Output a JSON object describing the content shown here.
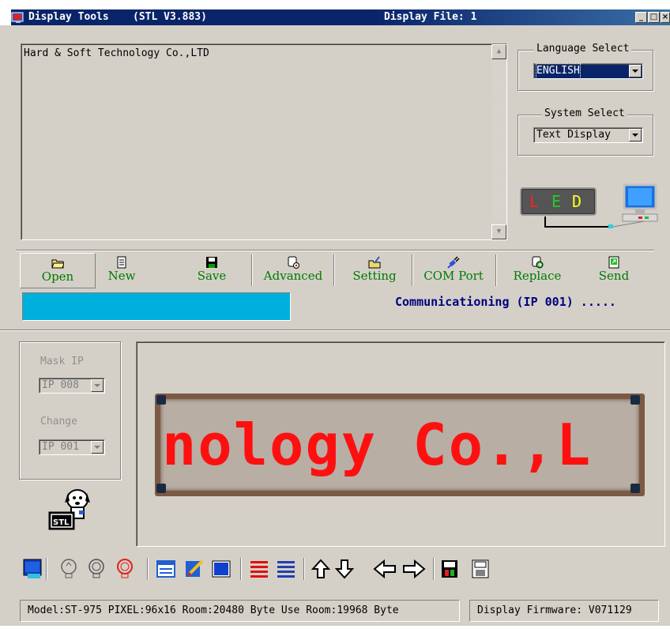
{
  "window": {
    "app_title": "Display Tools",
    "version": "(STL V3.883)",
    "file_label": "Display File: 1"
  },
  "editor": {
    "text": "Hard & Soft Technology Co.,LTD"
  },
  "language_select": {
    "legend": "Language Select",
    "value": "ENGLISH"
  },
  "system_select": {
    "legend": "System Select",
    "value": "Text Display"
  },
  "led_logo": {
    "letters": [
      "L",
      "E",
      "D"
    ],
    "colors": [
      "#ff2020",
      "#20d020",
      "#ffff20"
    ]
  },
  "toolbar": {
    "buttons": [
      {
        "label": "Open",
        "icon": "folder-open-icon"
      },
      {
        "label": "New",
        "icon": "new-document-icon"
      },
      {
        "label": "Save",
        "icon": "floppy-disk-icon"
      },
      {
        "label": "Advanced",
        "icon": "advanced-gear-icon"
      },
      {
        "label": "Setting",
        "icon": "setting-icon"
      },
      {
        "label": "COM Port",
        "icon": "com-port-plug-icon"
      },
      {
        "label": "Replace",
        "icon": "replace-icon"
      },
      {
        "label": "Send",
        "icon": "send-icon"
      }
    ]
  },
  "status": {
    "progress_fraction": 1.0,
    "text": "Communicationing (IP 001) ....."
  },
  "mask": {
    "mask_label": "Mask IP",
    "mask_value": "IP 008",
    "change_label": "Change",
    "change_value": "IP 001"
  },
  "mascot": {
    "badge_text": "STL"
  },
  "preview": {
    "text": "nology Co.,L",
    "text_color": "#ff1010"
  },
  "bottom_icons": [
    "screen-effect-icon",
    "bulb-outline-icon",
    "bulb-dim-icon",
    "bulb-red-icon",
    "window-frame-icon",
    "edit-pen-icon",
    "blue-block-icon",
    "red-lines-icon",
    "blue-lines-icon",
    "arrow-up-icon",
    "arrow-down-icon",
    "arrow-left-icon",
    "arrow-right-icon",
    "save-color-icon",
    "bmp-save-icon"
  ],
  "statusbar": {
    "info": "Model:ST-975  PIXEL:96x16  Room:20480 Byte Use Room:19968 Byte",
    "firmware": "Display Firmware: V071129"
  }
}
